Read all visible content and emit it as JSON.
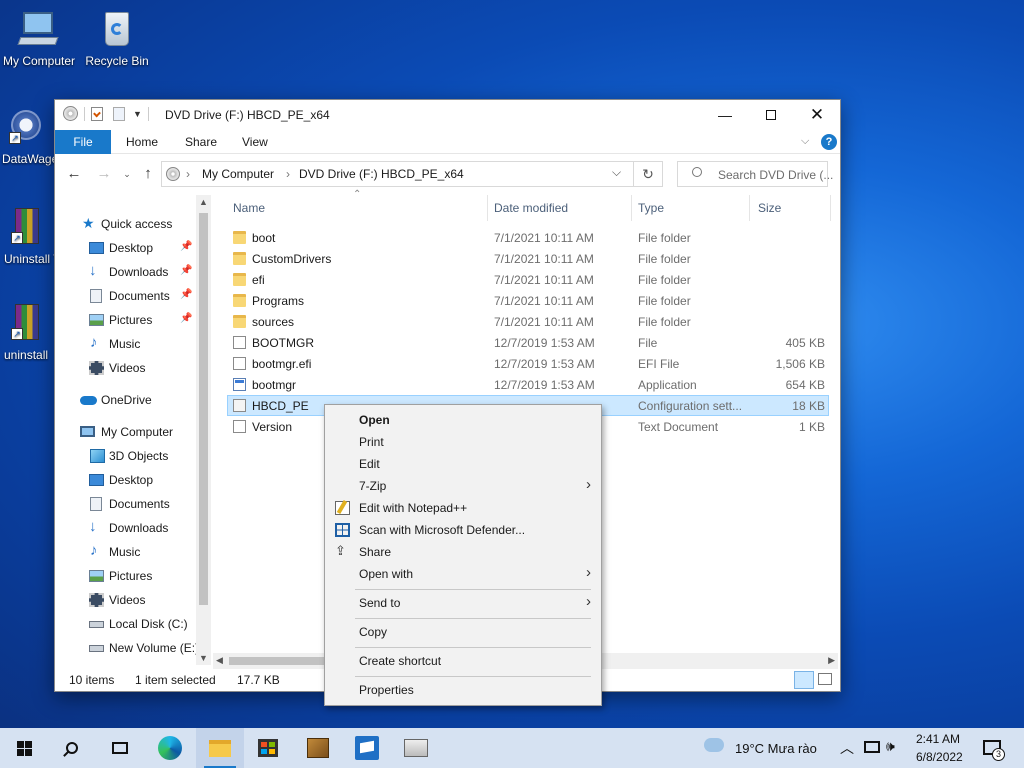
{
  "desktop": {
    "icons": [
      {
        "label": "My Computer",
        "icon": "computer-icon"
      },
      {
        "label": "Recycle Bin",
        "icon": "recycle-bin-icon"
      },
      {
        "label": "DataWage",
        "icon": "datawage-icon"
      },
      {
        "label": "Uninstall T",
        "icon": "winrar-icon"
      },
      {
        "label": "uninstall",
        "icon": "winrar-icon"
      }
    ]
  },
  "window": {
    "title": "DVD Drive (F:) HBCD_PE_x64",
    "ribbon_tabs": [
      "File",
      "Home",
      "Share",
      "View"
    ],
    "address": {
      "parts": [
        "My Computer",
        "DVD Drive (F:) HBCD_PE_x64"
      ]
    },
    "search_placeholder": "Search DVD Drive (...",
    "nav": {
      "quick_access": "Quick access",
      "quick_items": [
        "Desktop",
        "Downloads",
        "Documents",
        "Pictures",
        "Music",
        "Videos"
      ],
      "onedrive": "OneDrive",
      "my_computer": "My Computer",
      "pc_items": [
        "3D Objects",
        "Desktop",
        "Documents",
        "Downloads",
        "Music",
        "Pictures",
        "Videos",
        "Local Disk (C:)",
        "New Volume (E:)"
      ]
    },
    "columns": [
      "Name",
      "Date modified",
      "Type",
      "Size"
    ],
    "files": [
      {
        "name": "boot",
        "date": "7/1/2021 10:11 AM",
        "type": "File folder",
        "size": "",
        "kind": "folder"
      },
      {
        "name": "CustomDrivers",
        "date": "7/1/2021 10:11 AM",
        "type": "File folder",
        "size": "",
        "kind": "folder"
      },
      {
        "name": "efi",
        "date": "7/1/2021 10:11 AM",
        "type": "File folder",
        "size": "",
        "kind": "folder"
      },
      {
        "name": "Programs",
        "date": "7/1/2021 10:11 AM",
        "type": "File folder",
        "size": "",
        "kind": "folder"
      },
      {
        "name": "sources",
        "date": "7/1/2021 10:11 AM",
        "type": "File folder",
        "size": "",
        "kind": "folder"
      },
      {
        "name": "BOOTMGR",
        "date": "12/7/2019 1:53 AM",
        "type": "File",
        "size": "405 KB",
        "kind": "doc"
      },
      {
        "name": "bootmgr.efi",
        "date": "12/7/2019 1:53 AM",
        "type": "EFI File",
        "size": "1,506 KB",
        "kind": "doc"
      },
      {
        "name": "bootmgr",
        "date": "12/7/2019 1:53 AM",
        "type": "Application",
        "size": "654 KB",
        "kind": "app"
      },
      {
        "name": "HBCD_PE",
        "date": "",
        "type": "Configuration sett...",
        "size": "18 KB",
        "kind": "cfg"
      },
      {
        "name": "Version",
        "date": "",
        "type": "Text Document",
        "size": "1 KB",
        "kind": "doc"
      }
    ],
    "status": {
      "count": "10 items",
      "selected": "1 item selected",
      "size": "17.7 KB"
    }
  },
  "context_menu": {
    "items": [
      {
        "label": "Open",
        "bold": true
      },
      {
        "label": "Print"
      },
      {
        "label": "Edit"
      },
      {
        "label": "7-Zip",
        "submenu": true
      },
      {
        "label": "Edit with Notepad++",
        "icon": "notepad-icon"
      },
      {
        "label": "Scan with Microsoft Defender...",
        "icon": "defender-icon"
      },
      {
        "label": "Share",
        "icon": "share-icon"
      },
      {
        "label": "Open with",
        "submenu": true
      },
      {
        "label": "Send to",
        "submenu": true
      },
      {
        "label": "Copy"
      },
      {
        "label": "Create shortcut"
      },
      {
        "label": "Properties"
      }
    ]
  },
  "taskbar": {
    "weather": "19°C  Mưa rào",
    "time": "2:41 AM",
    "date": "6/8/2022",
    "notification_count": "3"
  }
}
